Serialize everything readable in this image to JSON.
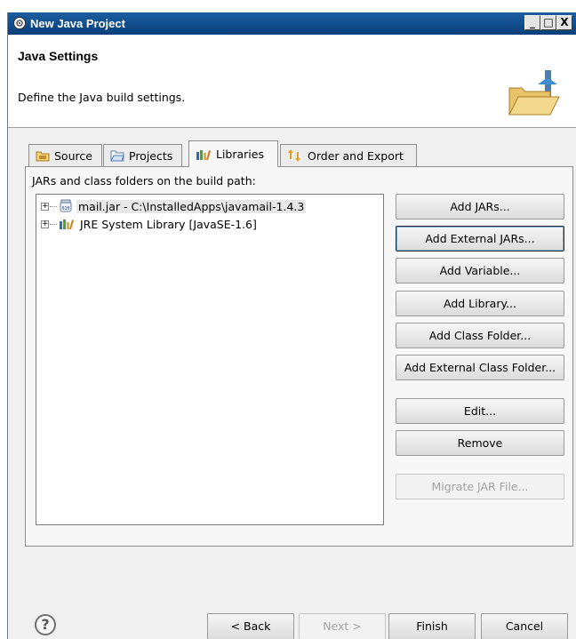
{
  "window": {
    "title": "New Java Project",
    "controls": {
      "minimize": "_",
      "maximize": "□",
      "close": "X"
    }
  },
  "header": {
    "title": "Java Settings",
    "description": "Define the Java build settings."
  },
  "tabs": [
    {
      "label": "Source",
      "icon": "source-folder-icon"
    },
    {
      "label": "Projects",
      "icon": "projects-folder-icon"
    },
    {
      "label": "Libraries",
      "icon": "libraries-icon",
      "active": true
    },
    {
      "label": "Order and Export",
      "icon": "order-export-icon"
    }
  ],
  "panel": {
    "label": "JARs and class folders on the build path:"
  },
  "tree": {
    "items": [
      {
        "label": "mail.jar - C:\\InstalledApps\\javamail-1.4.3",
        "icon": "jar-icon",
        "selected": true
      },
      {
        "label": "JRE System Library [JavaSE-1.6]",
        "icon": "library-icon",
        "selected": false
      }
    ]
  },
  "buttons": {
    "add_jars": "Add JARs...",
    "add_external_jars": "Add External JARs...",
    "add_variable": "Add Variable...",
    "add_library": "Add Library...",
    "add_class_folder": "Add Class Folder...",
    "add_external_class_folder": "Add External Class Folder...",
    "edit": "Edit...",
    "remove": "Remove",
    "migrate_jar": "Migrate JAR File..."
  },
  "footer": {
    "help": "?",
    "back": "< Back",
    "next": "Next >",
    "finish": "Finish",
    "cancel": "Cancel"
  }
}
